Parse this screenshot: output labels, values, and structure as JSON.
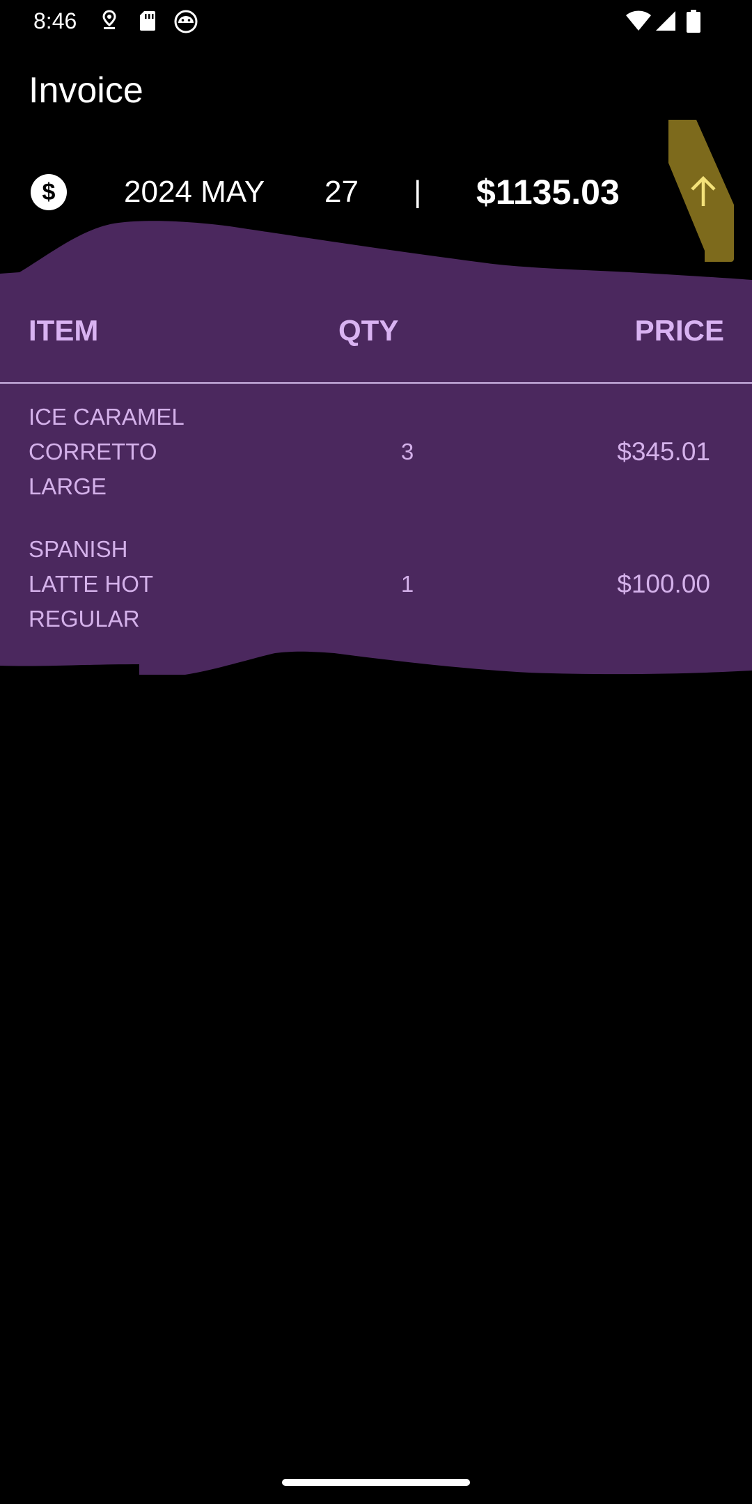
{
  "status_bar": {
    "time": "8:46",
    "icons": [
      "location-icon",
      "sd-card-icon",
      "android-head-icon",
      "wifi-icon",
      "signal-icon",
      "battery-icon"
    ]
  },
  "app_bar": {
    "title": "Invoice"
  },
  "summary": {
    "icon": "dollar-circle-icon",
    "year_month": "2024 MAY",
    "day": "27",
    "separator": "|",
    "total": "$1135.03",
    "sort_button_icon": "arrow-up-icon"
  },
  "table": {
    "headers": {
      "item": "ITEM",
      "qty": "QTY",
      "price": "PRICE"
    },
    "rows": [
      {
        "item_lines": [
          "ICE CARAMEL",
          "CORRETTO",
          "LARGE"
        ],
        "qty": "3",
        "price": "$345.01"
      },
      {
        "item_lines": [
          "SPANISH",
          "LATTE HOT",
          "REGULAR"
        ],
        "qty": "1",
        "price": "$100.00"
      }
    ]
  },
  "colors": {
    "background": "#000000",
    "sheet": "#4b285e",
    "header_text": "#d9b3f2",
    "row_text": "#d4b1ea",
    "sort_button": "#7d6a1c",
    "sort_arrow": "#f4e27a"
  }
}
